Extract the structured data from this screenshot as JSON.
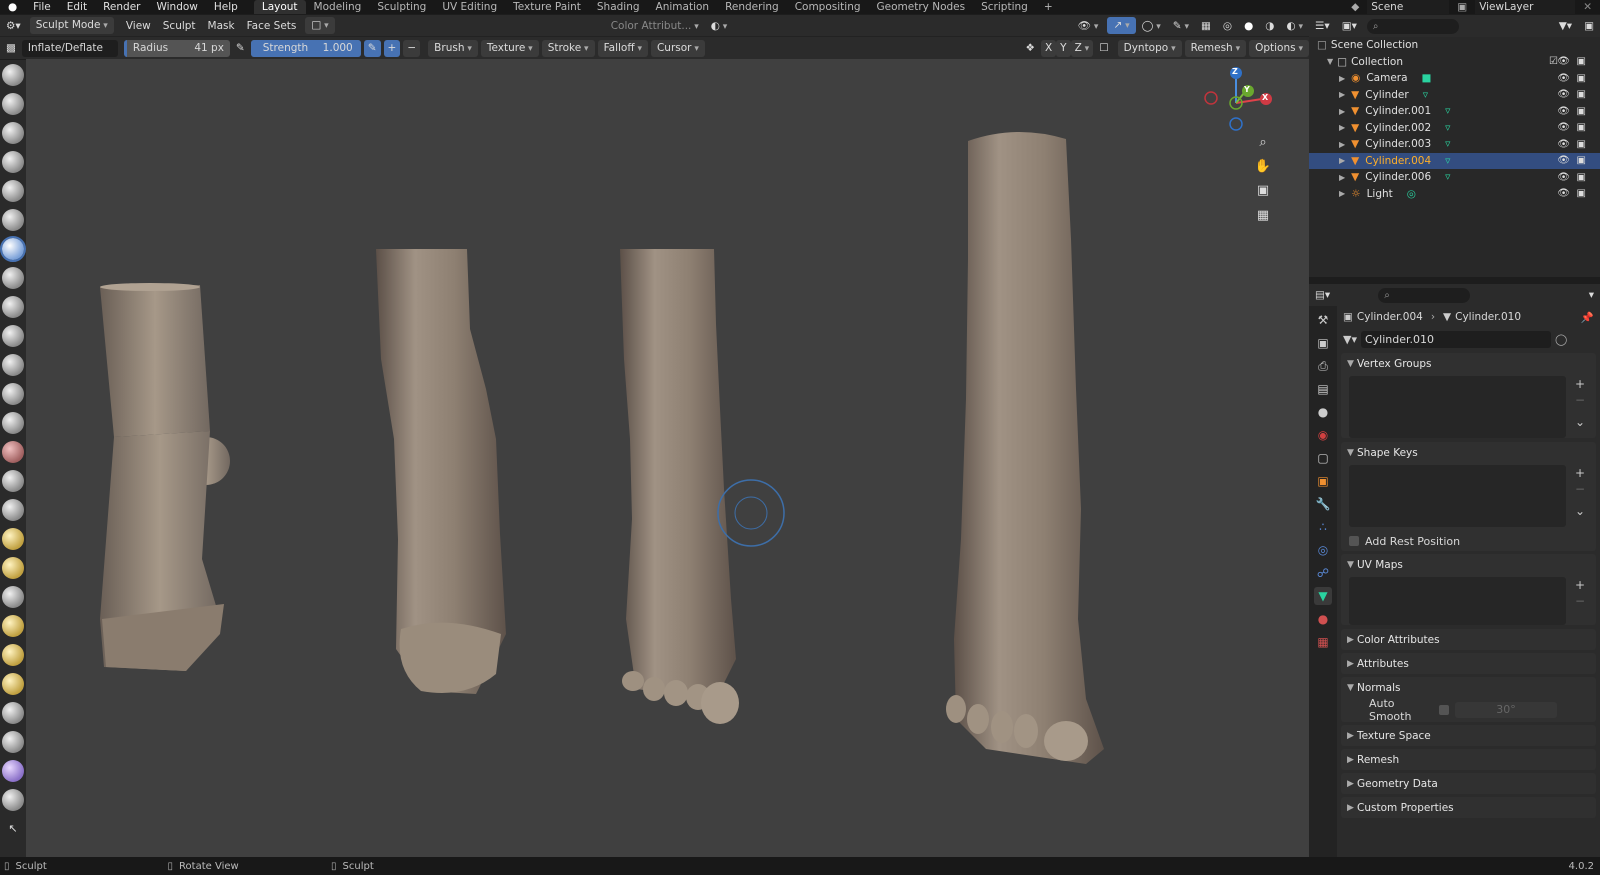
{
  "menu": [
    "File",
    "Edit",
    "Render",
    "Window",
    "Help"
  ],
  "workspaces": [
    "Layout",
    "Modeling",
    "Sculpting",
    "UV Editing",
    "Texture Paint",
    "Shading",
    "Animation",
    "Rendering",
    "Compositing",
    "Geometry Nodes",
    "Scripting"
  ],
  "active_workspace": "Layout",
  "scene": "Scene",
  "view_layer": "ViewLayer",
  "header": {
    "mode": "Sculpt Mode",
    "view": "View",
    "sculpt": "Sculpt",
    "mask": "Mask",
    "face_sets": "Face Sets",
    "color_attr": "Color Attribut..."
  },
  "tool_settings": {
    "brush_name": "Inflate/Deflate",
    "radius_label": "Radius",
    "radius_value": "41 px",
    "strength_label": "Strength",
    "strength_value": "1.000",
    "strength_fraction": 1.0,
    "brush": "Brush",
    "texture": "Texture",
    "stroke": "Stroke",
    "falloff": "Falloff",
    "cursor": "Cursor",
    "x": "X",
    "y": "Y",
    "z": "Z",
    "dyntopo": "Dyntopo",
    "remesh": "Remesh",
    "options": "Options"
  },
  "gizmo": {
    "x": "X",
    "y": "Y",
    "z": "Z"
  },
  "outliner": {
    "root": "Scene Collection",
    "collection": "Collection",
    "items": [
      {
        "name": "Camera",
        "type": "camera"
      },
      {
        "name": "Cylinder",
        "type": "mesh"
      },
      {
        "name": "Cylinder.001",
        "type": "mesh"
      },
      {
        "name": "Cylinder.002",
        "type": "mesh"
      },
      {
        "name": "Cylinder.003",
        "type": "mesh"
      },
      {
        "name": "Cylinder.004",
        "type": "mesh",
        "selected": true
      },
      {
        "name": "Cylinder.006",
        "type": "mesh"
      },
      {
        "name": "Light",
        "type": "light"
      }
    ]
  },
  "properties": {
    "object": "Cylinder.004",
    "mesh": "Cylinder.010",
    "datablock": "Cylinder.010",
    "panels": {
      "vertex_groups": "Vertex Groups",
      "shape_keys": "Shape Keys",
      "add_rest": "Add Rest Position",
      "uv_maps": "UV Maps",
      "color_attributes": "Color Attributes",
      "attributes": "Attributes",
      "normals": "Normals",
      "auto_smooth": "Auto Smooth",
      "auto_smooth_angle": "30°",
      "texture_space": "Texture Space",
      "remesh": "Remesh",
      "geometry_data": "Geometry Data",
      "custom_properties": "Custom Properties"
    }
  },
  "status": {
    "left": "Sculpt",
    "middle": "Rotate View",
    "right": "Sculpt",
    "version": "4.0.2"
  }
}
